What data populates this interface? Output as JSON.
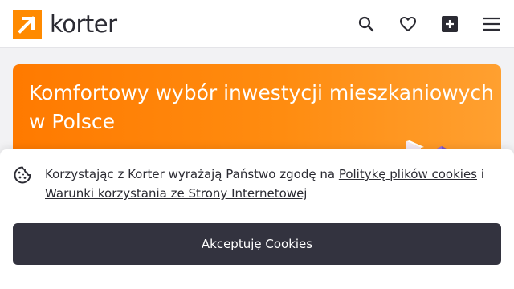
{
  "header": {
    "logo_text": "korter",
    "icons": {
      "search": "search-icon",
      "favorites": "heart-icon",
      "add": "plus-square-icon",
      "menu": "hamburger-menu-icon"
    }
  },
  "hero": {
    "title": "Komfortowy wybór inwestycji mieszkaniowych w Polsce"
  },
  "cookie_banner": {
    "icon": "cookie-icon",
    "text_before": "Korzystając z Korter wyrażają Państwo zgodę na ",
    "policy_link": "Politykę plików cookies",
    "text_between": " i ",
    "terms_link": "Warunki korzystania ze Strony Internetowej",
    "accept_label": "Akceptuję Cookies"
  },
  "colors": {
    "brand": "#ff8a00",
    "button": "#33333f",
    "text": "#2b2b33"
  }
}
